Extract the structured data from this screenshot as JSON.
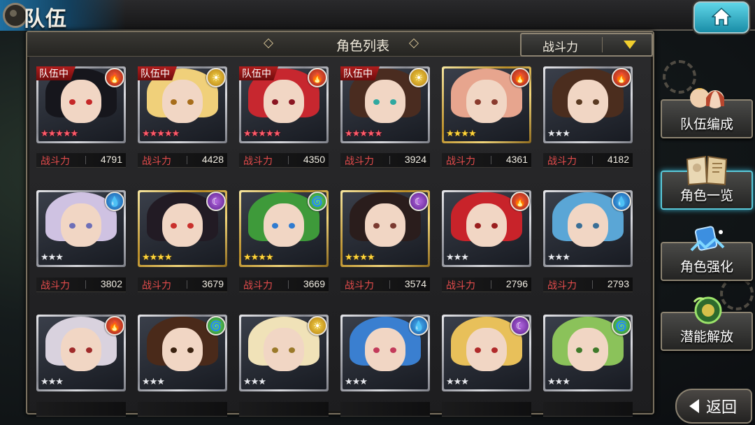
{
  "header": {
    "title": "队伍",
    "home_icon": "home-icon"
  },
  "panel": {
    "title": "角色列表",
    "sort": {
      "selected": "战斗力",
      "arrow_icon": "dropdown-triangle-icon"
    }
  },
  "power_label": "战斗力",
  "party_tag": "队伍中",
  "characters": [
    {
      "element": "fire",
      "in_party": true,
      "stars": 5,
      "rarity": "red",
      "frame": "silver",
      "power": "4791",
      "hair": "#16161c",
      "eye": "#c52727"
    },
    {
      "element": "light",
      "in_party": true,
      "stars": 5,
      "rarity": "red",
      "frame": "silver",
      "power": "4428",
      "hair": "#f0d07a",
      "eye": "#a76d1a"
    },
    {
      "element": "fire",
      "in_party": true,
      "stars": 5,
      "rarity": "red",
      "frame": "silver",
      "power": "4350",
      "hair": "#c7272f",
      "eye": "#8a1622"
    },
    {
      "element": "light",
      "in_party": true,
      "stars": 5,
      "rarity": "red",
      "frame": "silver",
      "power": "3924",
      "hair": "#4a2c20",
      "eye": "#2fa8a0"
    },
    {
      "element": "fire",
      "in_party": false,
      "stars": 4,
      "rarity": "gold",
      "frame": "gold",
      "power": "4361",
      "hair": "#e7a58e",
      "eye": "#8a3b2e"
    },
    {
      "element": "fire",
      "in_party": false,
      "stars": 3,
      "rarity": "silver",
      "frame": "silver",
      "power": "4182",
      "hair": "#4b2d1e",
      "eye": "#5a3a22"
    },
    {
      "element": "water",
      "in_party": false,
      "stars": 3,
      "rarity": "silver",
      "frame": "silver",
      "power": "3802",
      "hair": "#cfc2e2",
      "eye": "#6d6fb8"
    },
    {
      "element": "dark",
      "in_party": false,
      "stars": 4,
      "rarity": "gold",
      "frame": "gold",
      "power": "3679",
      "hair": "#221b24",
      "eye": "#c9302c"
    },
    {
      "element": "wind",
      "in_party": false,
      "stars": 4,
      "rarity": "gold",
      "frame": "gold",
      "power": "3669",
      "hair": "#3e9a3a",
      "eye": "#2f7bd0"
    },
    {
      "element": "dark",
      "in_party": false,
      "stars": 4,
      "rarity": "gold",
      "frame": "gold",
      "power": "3574",
      "hair": "#2a1d1c",
      "eye": "#7a3a30"
    },
    {
      "element": "fire",
      "in_party": false,
      "stars": 3,
      "rarity": "silver",
      "frame": "silver",
      "power": "2796",
      "hair": "#c8232a",
      "eye": "#9a1e1e"
    },
    {
      "element": "water",
      "in_party": false,
      "stars": 3,
      "rarity": "silver",
      "frame": "silver",
      "power": "2793",
      "hair": "#5aa6d6",
      "eye": "#3a6f96"
    },
    {
      "element": "fire",
      "in_party": false,
      "stars": 3,
      "rarity": "silver",
      "frame": "silver",
      "power": "",
      "hair": "#d9d2de",
      "eye": "#a02a2a"
    },
    {
      "element": "wind",
      "in_party": false,
      "stars": 3,
      "rarity": "silver",
      "frame": "silver",
      "power": "",
      "hair": "#4a2a1a",
      "eye": "#3a2210"
    },
    {
      "element": "light",
      "in_party": false,
      "stars": 3,
      "rarity": "silver",
      "frame": "silver",
      "power": "",
      "hair": "#f0e2b8",
      "eye": "#9b7a2a"
    },
    {
      "element": "water",
      "in_party": false,
      "stars": 3,
      "rarity": "silver",
      "frame": "silver",
      "power": "",
      "hair": "#3a7fd0",
      "eye": "#c33a5a"
    },
    {
      "element": "dark",
      "in_party": false,
      "stars": 3,
      "rarity": "silver",
      "frame": "silver",
      "power": "",
      "hair": "#e8c05a",
      "eye": "#b02a2a"
    },
    {
      "element": "wind",
      "in_party": false,
      "stars": 3,
      "rarity": "silver",
      "frame": "silver",
      "power": "",
      "hair": "#8bc25a",
      "eye": "#3f7a2a"
    }
  ],
  "side_menu": [
    {
      "label": "队伍编成",
      "icon": "team-portraits-icon",
      "active": false
    },
    {
      "label": "角色一览",
      "icon": "book-icon",
      "active": true
    },
    {
      "label": "角色强化",
      "icon": "enhance-crystal-icon",
      "active": false
    },
    {
      "label": "潜能解放",
      "icon": "potential-orb-icon",
      "active": false
    }
  ],
  "back_button": {
    "label": "返回",
    "icon": "back-arrow-icon"
  },
  "colors": {
    "accent": "#59c9da",
    "power_label": "#e54c4c",
    "party_tag": "#b11d1d",
    "sort_arrow": "#f2cf2e"
  }
}
